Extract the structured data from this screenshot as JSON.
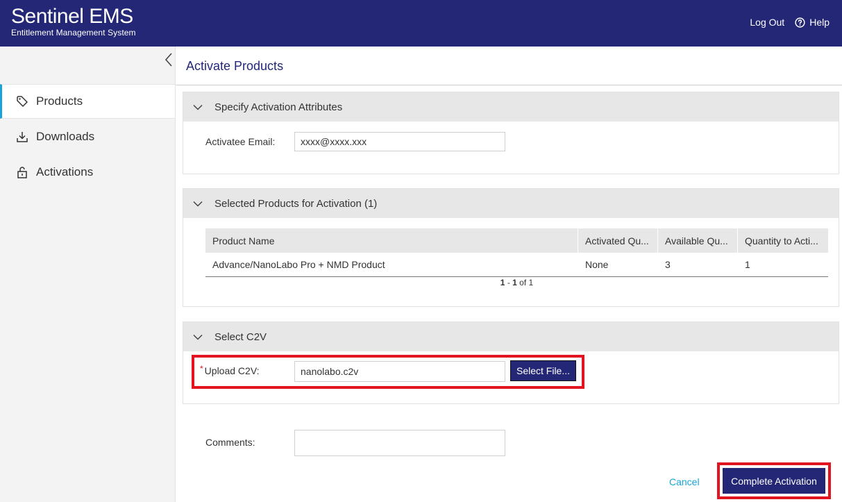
{
  "header": {
    "brand_title": "Sentinel EMS",
    "brand_subtitle": "Entitlement Management System",
    "logout_label": "Log Out",
    "help_label": "Help",
    "background": "#232776"
  },
  "sidebar": {
    "items": [
      {
        "label": "Products",
        "icon": "tag-icon",
        "active": true
      },
      {
        "label": "Downloads",
        "icon": "download-icon",
        "active": false
      },
      {
        "label": "Activations",
        "icon": "lock-open-icon",
        "active": false
      }
    ]
  },
  "main": {
    "page_title": "Activate Products",
    "attributes_panel": {
      "title": "Specify Activation Attributes",
      "email_label": "Activatee Email:",
      "email_value": "xxxx@xxxx.xxx"
    },
    "products_panel": {
      "title": "Selected Products for Activation (1)",
      "columns": [
        "Product Name",
        "Activated Qu...",
        "Available Qu...",
        "Quantity to Acti..."
      ],
      "rows": [
        [
          "Advance/NanoLabo Pro + NMD Product",
          "None",
          "3",
          "1"
        ]
      ],
      "pager": {
        "from": "1",
        "sep": " - ",
        "to": "1",
        "of_text": " of 1"
      }
    },
    "c2v_panel": {
      "title": "Select C2V",
      "required_mark": "*",
      "upload_label": "Upload C2V:",
      "file_value": "nanolabo.c2v",
      "select_file_label": "Select File..."
    },
    "comments_label": "Comments:",
    "comments_value": "",
    "cancel_label": "Cancel",
    "complete_label": "Complete Activation"
  },
  "colors": {
    "brand": "#232776",
    "accent": "#1aa3d9",
    "highlight": "#e2141f"
  }
}
